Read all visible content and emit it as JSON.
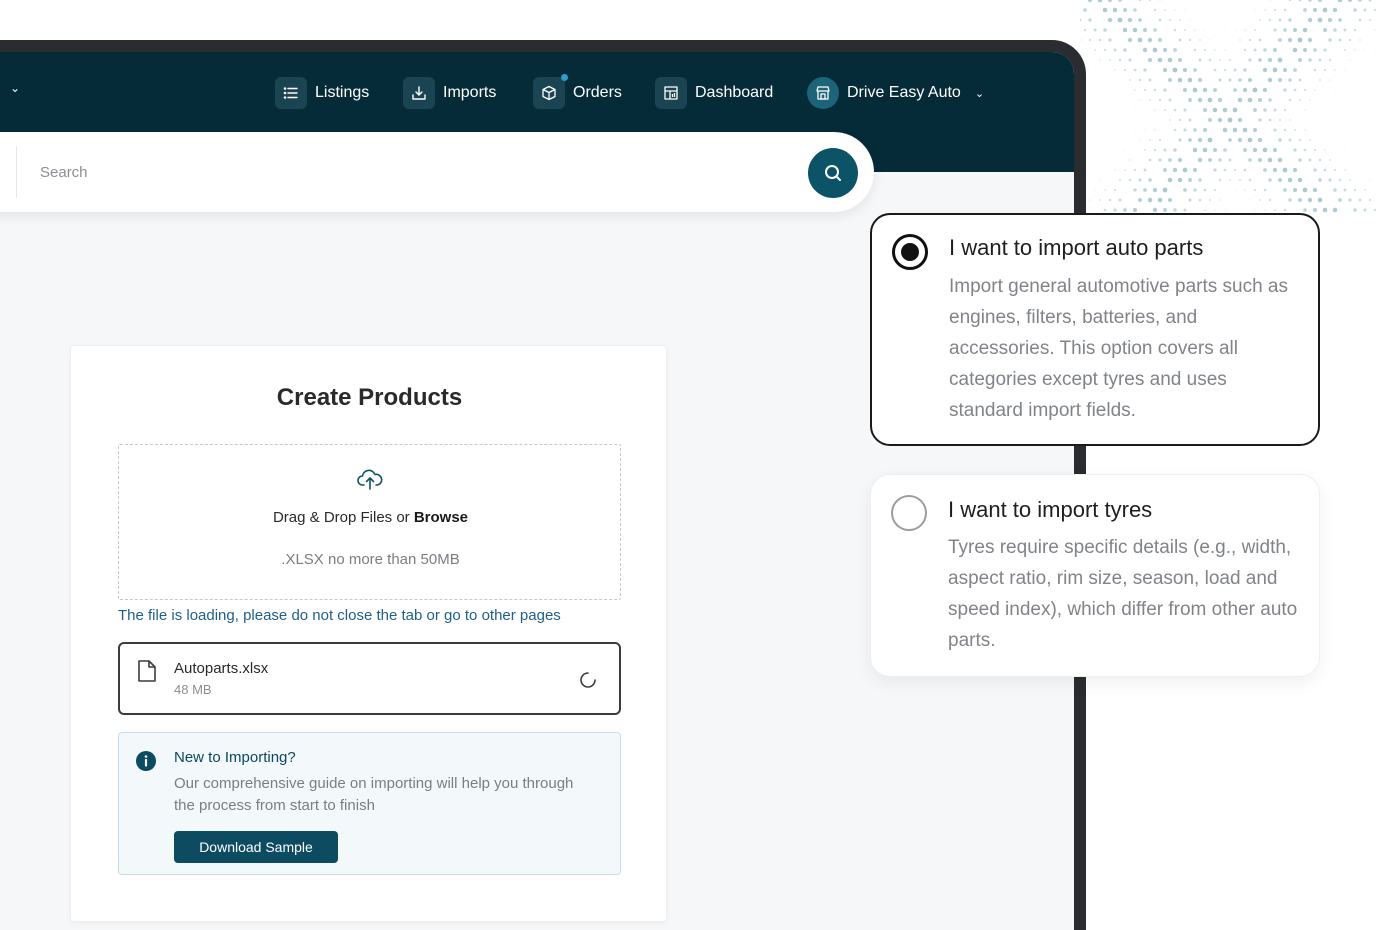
{
  "nav": {
    "items": [
      {
        "label": "Listings",
        "icon": "list-icon"
      },
      {
        "label": "Imports",
        "icon": "download-icon"
      },
      {
        "label": "Orders",
        "icon": "package-icon"
      },
      {
        "label": "Dashboard",
        "icon": "dashboard-icon"
      }
    ],
    "store": {
      "label": "Drive Easy Auto",
      "icon": "store-icon"
    }
  },
  "search": {
    "placeholder": "Search"
  },
  "create": {
    "title": "Create Products",
    "drop_text": "Drag & Drop Files or ",
    "browse_label": "Browse",
    "hint": ".XLSX no more than 50MB",
    "loading_message": "The file is loading, please do not close the tab or go to other pages",
    "file": {
      "name": "Autoparts.xlsx",
      "size": "48 MB"
    },
    "info": {
      "title": "New to Importing?",
      "body": "Our comprehensive guide on importing will help you through the process from start to finish",
      "button_label": "Download Sample"
    }
  },
  "options": [
    {
      "title": "I want to import auto parts",
      "description": "Import general automotive parts such as engines, filters, batteries, and accessories. This option covers all categories except tyres and uses standard import fields.",
      "selected": true
    },
    {
      "title": "I want to import tyres",
      "description": "Tyres require specific details (e.g., width, aspect ratio, rim size, season, load and speed index), which differ from other auto parts.",
      "selected": false
    }
  ],
  "colors": {
    "nav_bg": "#062b38",
    "accent": "#0d5368",
    "link": "#1f5f8b"
  }
}
